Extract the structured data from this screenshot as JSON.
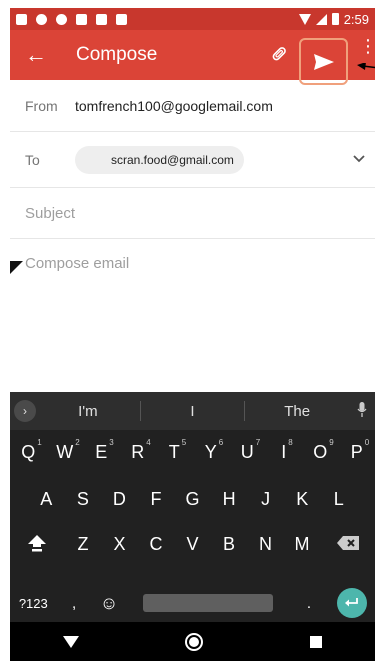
{
  "status_bar": {
    "time": "2:59",
    "icons": [
      "notification-icon",
      "messenger-icon",
      "alarm-icon",
      "gallery-icon",
      "sim-icon",
      "cast-icon"
    ]
  },
  "app_bar": {
    "title": "Compose",
    "back_icon": "←",
    "attach_icon": "📎",
    "more_icon": "⋮"
  },
  "from": {
    "label": "From",
    "value": "tomfrench100@googlemail.com"
  },
  "to": {
    "label": "To",
    "recipient": "scran.food@gmail.com",
    "chevron": "⌄"
  },
  "subject": {
    "placeholder": "Subject"
  },
  "body": {
    "placeholder": "Compose email"
  },
  "keyboard": {
    "suggestions": [
      "I'm",
      "I",
      "The"
    ],
    "row1": [
      "Q",
      "W",
      "E",
      "R",
      "T",
      "Y",
      "U",
      "I",
      "O",
      "P"
    ],
    "row1_nums": [
      "1",
      "2",
      "3",
      "4",
      "5",
      "6",
      "7",
      "8",
      "9",
      "0"
    ],
    "row2": [
      "A",
      "S",
      "D",
      "F",
      "G",
      "H",
      "J",
      "K",
      "L"
    ],
    "row3": [
      "Z",
      "X",
      "C",
      "V",
      "B",
      "N",
      "M"
    ],
    "symbols_key": "?123",
    "comma_key": ",",
    "emoji_key": "☺",
    "period_key": "."
  },
  "colors": {
    "status_bar": "#c8372d",
    "app_bar": "#db4437",
    "send_highlight": "#f0a07c",
    "enter_key": "#4db6ac"
  }
}
